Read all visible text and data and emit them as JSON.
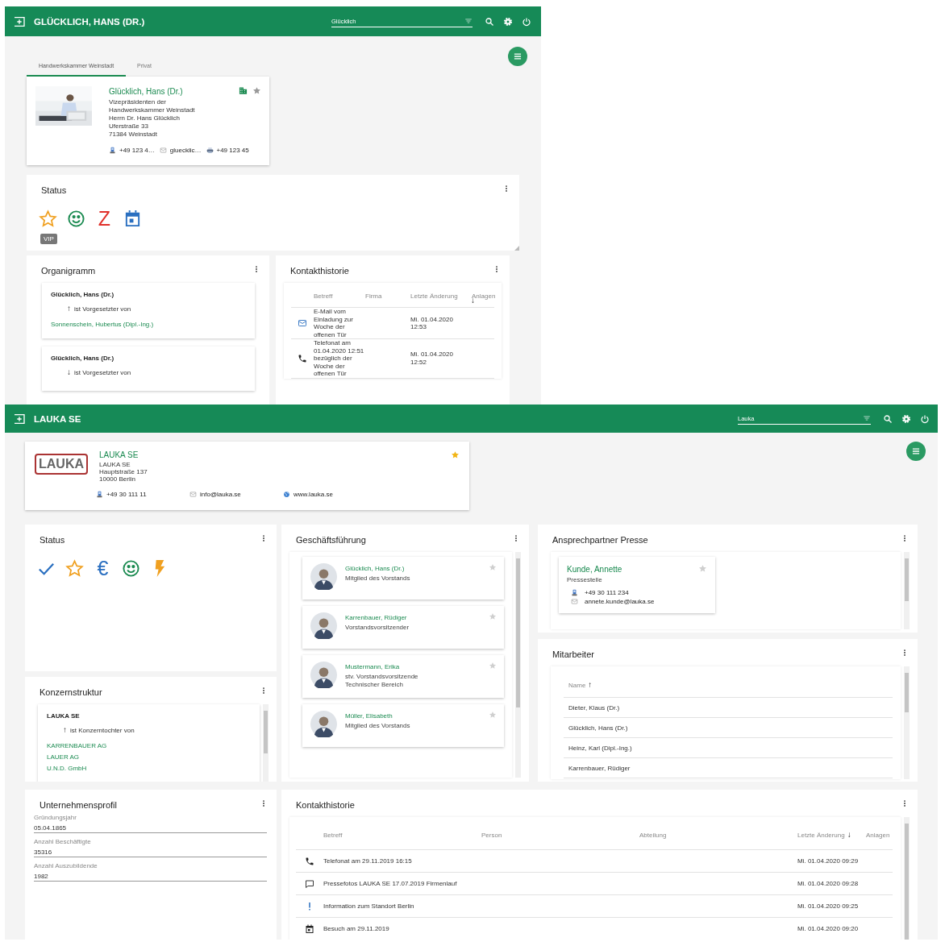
{
  "person_screen": {
    "header": {
      "title": "GLÜCKLICH, HANS (DR.)",
      "search_value": "Glücklich"
    },
    "tabs": [
      {
        "label": "Handwerkskammer Weinstadt",
        "selected": true
      },
      {
        "label": "Privat",
        "selected": false
      }
    ],
    "contact_card": {
      "name": "Glücklich, Hans (Dr.)",
      "favorite": false,
      "lines": [
        "Vizepräsidenten der",
        "Handwerkskammer Weinstadt",
        "Herrn Dr. Hans Glücklich",
        "Uferstraße 33",
        "71384 Weinstadt"
      ],
      "contacts": [
        {
          "kind": "phone",
          "text": "+49 123 4…"
        },
        {
          "kind": "email",
          "text": "gluecklic…"
        },
        {
          "kind": "fax",
          "text": "+49 123 45"
        }
      ]
    },
    "status": {
      "title": "Status",
      "icons": [
        {
          "kind": "star",
          "color": "#f0a020"
        },
        {
          "kind": "smiley",
          "color": "#1a8a50"
        },
        {
          "kind": "glyph",
          "text": "Z",
          "color": "#e0302a"
        },
        {
          "kind": "calendar",
          "color": "#2a6fc0"
        }
      ],
      "badge": "VIP"
    },
    "organigramm": {
      "title": "Organigramm",
      "entries": [
        {
          "name": "Glücklich, Hans (Dr.)",
          "direction": "↑",
          "relation": "ist Vorgesetzter von",
          "targets": [
            "Sonnenschein, Hubertus (Dipl.-Ing.)"
          ]
        },
        {
          "name": "Glücklich, Hans (Dr.)",
          "direction": "↓",
          "relation": "ist Vorgesetzter von"
        }
      ]
    },
    "history": {
      "title": "Kontakthistorie",
      "columns": [
        {
          "label": "Betreff"
        },
        {
          "label": "Firma"
        },
        {
          "label": "Letzte Änderung",
          "sort": "↓"
        },
        {
          "label": "Anlagen"
        }
      ],
      "rows": [
        {
          "kind": "email",
          "subject": "E-Mail vom Einladung zur Woche der offenen Tür",
          "date": "Mi. 01.04.2020 12:53"
        },
        {
          "kind": "phone",
          "subject": "Telefonat am 01.04.2020 12:51 bezüglich der Woche der offenen Tür",
          "date": "Mi. 01.04.2020 12:52"
        }
      ]
    }
  },
  "company_screen": {
    "header": {
      "title": "LAUKA SE",
      "search_value": "Lauka"
    },
    "company_card": {
      "logo": "LAUKA",
      "name": "LAUKA SE",
      "favorite": true,
      "lines": [
        "LAUKA SE",
        "Hauptstraße 137",
        "10000 Berlin"
      ],
      "contacts": [
        {
          "kind": "phone",
          "text": "+49 30 111 11"
        },
        {
          "kind": "email",
          "text": "info@lauka.se"
        },
        {
          "kind": "web",
          "text": "www.lauka.se"
        }
      ]
    },
    "status": {
      "title": "Status",
      "icons": [
        {
          "kind": "check",
          "color": "#2a6fc0"
        },
        {
          "kind": "star",
          "color": "#f0a020"
        },
        {
          "kind": "glyph",
          "text": "€",
          "color": "#2a6fc0"
        },
        {
          "kind": "smiley",
          "color": "#1a8a50"
        },
        {
          "kind": "bolt",
          "color": "#f0a020"
        }
      ]
    },
    "group_structure": {
      "title": "Konzernstruktur",
      "entries": [
        {
          "name": "LAUKA SE",
          "direction": "↑",
          "relation": "ist Konzerntochter von",
          "targets": [
            "KARRENBAUER AG",
            "LAUER AG",
            "U.N.D. GmbH"
          ]
        }
      ]
    },
    "management": {
      "title": "Geschäftsführung",
      "people": [
        {
          "name": "Glücklich, Hans (Dr.)",
          "roles": [
            "Mitglied des Vorstands"
          ],
          "favorite": false
        },
        {
          "name": "Karrenbauer, Rüdiger",
          "roles": [
            "Vorstandsvorsitzender"
          ],
          "favorite": false
        },
        {
          "name": "Mustermann, Erika",
          "roles": [
            "stv. Vorstandsvorsitzende",
            "Technischer Bereich"
          ],
          "favorite": false
        },
        {
          "name": "Müller, Elisabeth",
          "roles": [
            "Mitglied des Vorstands"
          ],
          "favorite": false
        }
      ]
    },
    "press_contact": {
      "title": "Ansprechpartner Presse",
      "name": "Kunde, Annette",
      "role": "Pressestelle",
      "favorite": false,
      "phone": "+49 30 111 234",
      "email": "annete.kunde@lauka.se"
    },
    "employees": {
      "title": "Mitarbeiter",
      "column": {
        "label": "Name",
        "sort": "↑"
      },
      "rows": [
        "Dieter, Klaus (Dr.)",
        "Glücklich, Hans (Dr.)",
        "Heinz, Karl (Dipl.-Ing.)",
        "Karrenbauer, Rüdiger"
      ]
    },
    "profile": {
      "title": "Unternehmensprofil",
      "fields": [
        {
          "label": "Gründungsjahr",
          "value": "05.04.1865"
        },
        {
          "label": "Anzahl Beschäftigte",
          "value": "35316"
        },
        {
          "label": "Anzahl Auszubildende",
          "value": "1982"
        }
      ]
    },
    "history": {
      "title": "Kontakthistorie",
      "columns": [
        {
          "label": "Betreff"
        },
        {
          "label": "Person"
        },
        {
          "label": "Abteilung"
        },
        {
          "label": "Letzte Änderung",
          "sort": "↓"
        },
        {
          "label": "Anlagen"
        }
      ],
      "rows": [
        {
          "kind": "phone",
          "subject": "Telefonat am 29.11.2019 16:15",
          "date": "Mi. 01.04.2020 09:29"
        },
        {
          "kind": "chat",
          "subject": "Pressefotos LAUKA SE 17.07.2019 Firmenlauf",
          "date": "Mi. 01.04.2020 09:28"
        },
        {
          "kind": "info",
          "subject": "Information zum Standort Berlin",
          "date": "Mi. 01.04.2020 09:25"
        },
        {
          "kind": "calendar",
          "subject": "Besuch am 29.11.2019",
          "date": "Mi. 01.04.2020 09:20"
        }
      ]
    }
  }
}
